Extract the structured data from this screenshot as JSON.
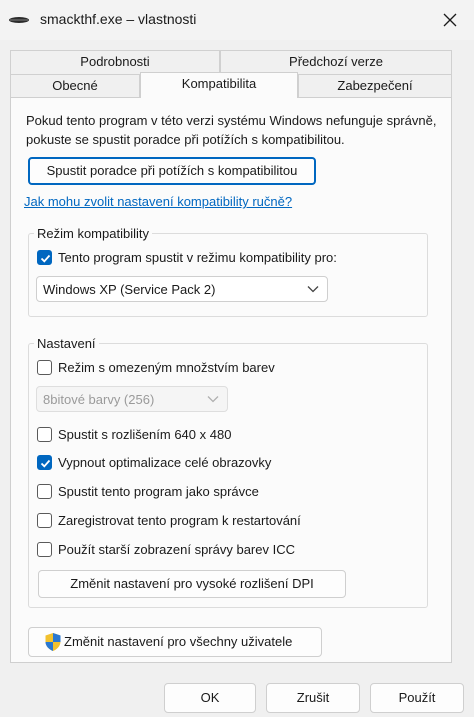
{
  "window": {
    "title": "smackthf.exe – vlastnosti"
  },
  "tabs": {
    "row1": [
      "Podrobnosti",
      "Předchozí verze"
    ],
    "row2": [
      "Obecné",
      "Kompatibilita",
      "Zabezpečení"
    ],
    "active": "Kompatibilita"
  },
  "intro": "Pokud tento program v této verzi systému Windows nefunguje správně, pokuste se spustit poradce při potížích s kompatibilitou.",
  "troubleshooter_button": "Spustit poradce při potížích s kompatibilitou",
  "manual_link": "Jak mohu zvolit nastavení kompatibility ručně?",
  "compat_mode": {
    "label": "Režim kompatibility",
    "checkbox": {
      "label": "Tento program spustit v režimu kompatibility pro:",
      "checked": true
    },
    "selected": "Windows XP (Service Pack 2)"
  },
  "settings": {
    "label": "Nastavení",
    "reduced_color": {
      "label": "Režim s omezeným množstvím barev",
      "checked": false
    },
    "color_select": "8bitové barvy (256)",
    "res_640": {
      "label": "Spustit s rozlišením 640 x 480",
      "checked": false
    },
    "disable_fullscreen": {
      "label": "Vypnout optimalizace celé obrazovky",
      "checked": true
    },
    "run_admin": {
      "label": "Spustit tento program jako správce",
      "checked": false
    },
    "register_restart": {
      "label": "Zaregistrovat tento program k restartování",
      "checked": false
    },
    "legacy_icc": {
      "label": "Použít starší zobrazení správy barev ICC",
      "checked": false
    },
    "dpi_button": "Změnit nastavení pro vysoké rozlišení DPI"
  },
  "all_users_button": "Změnit nastavení pro všechny uživatele",
  "footer": {
    "ok": "OK",
    "cancel": "Zrušit",
    "apply": "Použít"
  },
  "colors": {
    "accent": "#0067c0",
    "panel": "#fbfbfb",
    "window": "#f0f0f0"
  }
}
